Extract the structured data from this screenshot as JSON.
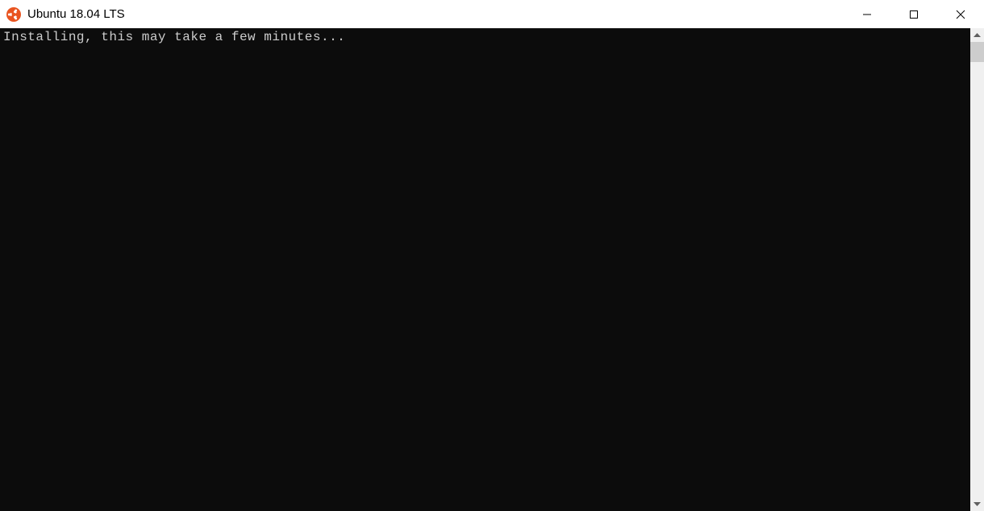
{
  "window": {
    "title": "Ubuntu 18.04 LTS",
    "icon_color": "#E95420"
  },
  "terminal": {
    "lines": [
      "Installing, this may take a few minutes..."
    ]
  }
}
